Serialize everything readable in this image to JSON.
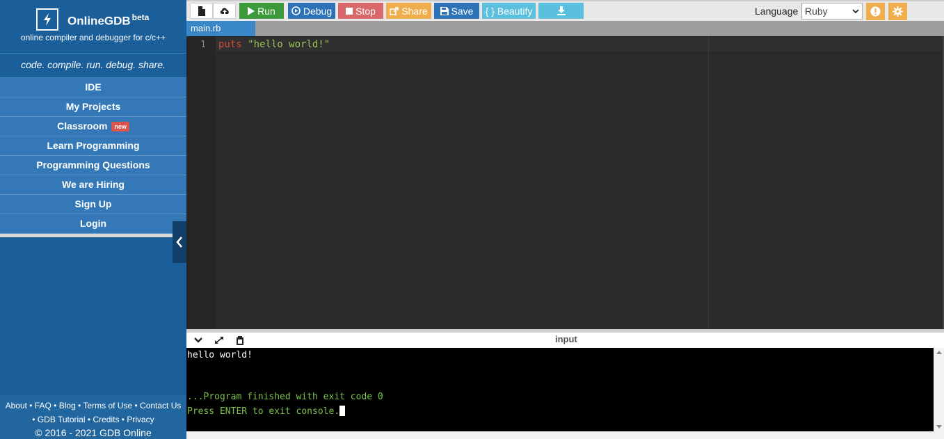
{
  "sidebar": {
    "brand_name": "OnlineGDB",
    "brand_sup": "beta",
    "brand_sub": "online compiler and debugger for c/c++",
    "tagline": "code. compile. run. debug. share.",
    "items": [
      {
        "label": "IDE"
      },
      {
        "label": "My Projects"
      },
      {
        "label": "Classroom",
        "badge": "new"
      },
      {
        "label": "Learn Programming"
      },
      {
        "label": "Programming Questions"
      },
      {
        "label": "We are Hiring"
      },
      {
        "label": "Sign Up"
      },
      {
        "label": "Login"
      }
    ],
    "footer": {
      "links1": [
        "About",
        "FAQ",
        "Blog",
        "Terms of Use",
        "Contact Us"
      ],
      "links2": [
        "GDB Tutorial",
        "Credits",
        "Privacy"
      ],
      "sep": "•",
      "copyright": "© 2016 - 2021 GDB Online"
    }
  },
  "toolbar": {
    "run": "Run",
    "debug": "Debug",
    "stop": "Stop",
    "share": "Share",
    "save": "Save",
    "beautify": "{ } Beautify",
    "language_label": "Language",
    "language_value": "Ruby"
  },
  "tabs": [
    {
      "label": "main.rb"
    }
  ],
  "editor": {
    "line_number": "1",
    "keyword": "puts",
    "string": "\"hello world!\""
  },
  "console": {
    "title": "input",
    "output": "hello world!",
    "finished": "...Program finished with exit code 0",
    "press": "Press ENTER to exit console."
  },
  "colors": {
    "run": "#3c9a3c",
    "debug": "#2e72b8",
    "stop": "#d9686a",
    "share": "#f0ad4e",
    "save": "#2e72b8",
    "beautify": "#5bc0de",
    "download": "#5bc0de",
    "sidebar": "#1a5e9a"
  }
}
